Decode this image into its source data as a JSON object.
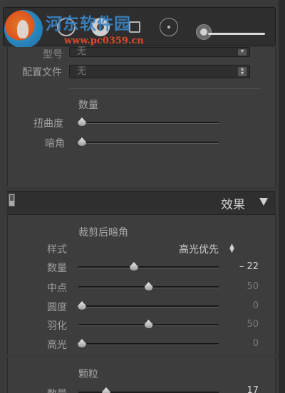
{
  "watermark": {
    "title": "河东软件园",
    "url": "www.pc0359.cn"
  },
  "toolbar": {
    "tools": [
      "crop-circle-icon",
      "spot-removal-icon",
      "graduated-filter-icon",
      "radial-filter-icon",
      "brush-icon"
    ]
  },
  "lens": {
    "model_label": "型号",
    "model_value": "无",
    "profile_label": "配置文件",
    "profile_value": "无",
    "amount_title": "数量",
    "distortion_label": "扭曲度",
    "vignetting_label": "暗角"
  },
  "effects": {
    "header": "效果",
    "post_crop_title": "裁剪后暗角",
    "style_label": "样式",
    "style_value": "高光优先",
    "sliders": [
      {
        "label": "数量",
        "value": "– 22",
        "level": -22,
        "active": true
      },
      {
        "label": "中点",
        "value": "50",
        "level": 50,
        "active": false
      },
      {
        "label": "圆度",
        "value": "0",
        "level": 0,
        "active": false
      },
      {
        "label": "羽化",
        "value": "50",
        "level": 50,
        "active": false
      },
      {
        "label": "高光",
        "value": "0",
        "level": 0,
        "active": false
      }
    ],
    "grain_title": "颗粒",
    "grain_amount_label": "数量",
    "grain_amount_value": "17"
  },
  "colors": {
    "panel": "#3d3d3d",
    "header": "#2f2f2f",
    "text": "#a9a9a9",
    "watermark_blue": "#3a86c8",
    "watermark_red": "#e04a2a"
  }
}
